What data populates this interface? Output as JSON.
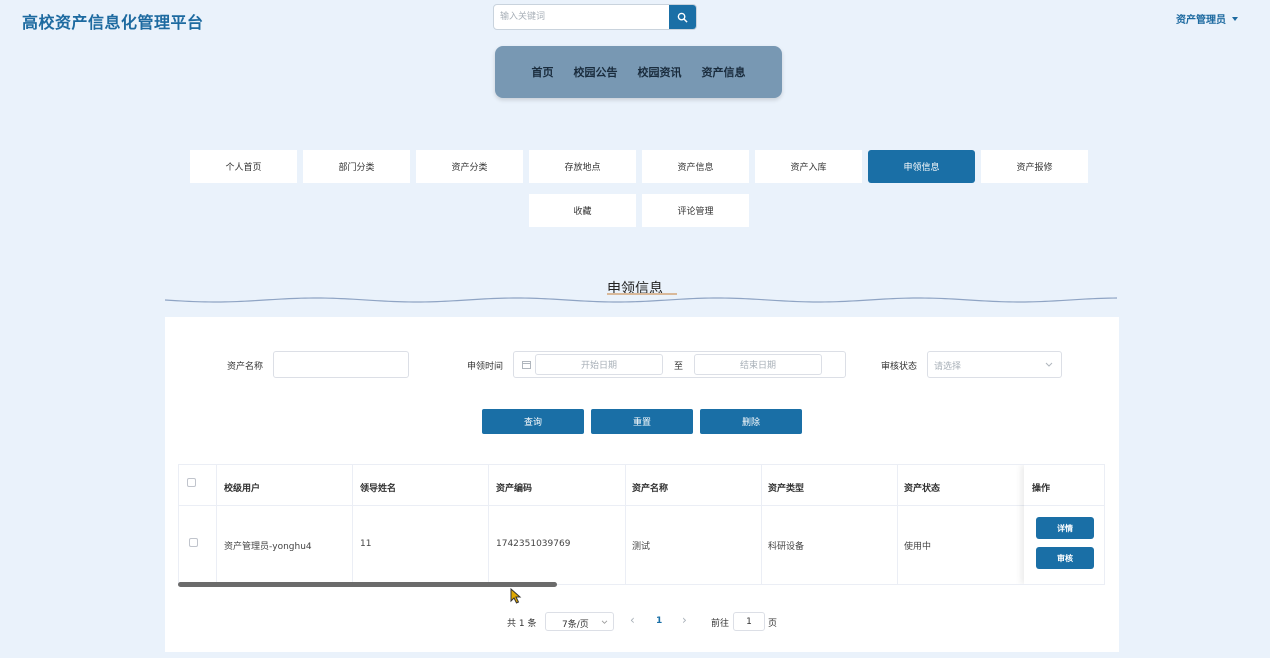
{
  "header": {
    "app_title": "高校资产信息化管理平台",
    "search_placeholder": "输入关键词",
    "user_label": "资产管理员"
  },
  "topnav": [
    "首页",
    "校园公告",
    "校园资讯",
    "资产信息"
  ],
  "tabs": [
    "个人首页",
    "部门分类",
    "资产分类",
    "存放地点",
    "资产信息",
    "资产入库",
    "申领信息",
    "资产报修",
    "收藏",
    "评论管理"
  ],
  "active_tab": "申领信息",
  "section_title": "申领信息",
  "filters": {
    "asset_name_label": "资产名称",
    "apply_time_label": "申领时间",
    "start_placeholder": "开始日期",
    "range_sep": "至",
    "end_placeholder": "结束日期",
    "review_status_label": "审核状态",
    "select_placeholder": "请选择"
  },
  "buttons": {
    "query": "查询",
    "reset": "重置",
    "delete": "删除"
  },
  "table": {
    "columns": [
      "校级用户",
      "领导姓名",
      "资产编码",
      "资产名称",
      "资产类型",
      "资产状态",
      "操作"
    ],
    "rows": [
      {
        "user": "资产管理员-yonghu4",
        "leader": "11",
        "code": "1742351039769",
        "name": "测试",
        "type": "科研设备",
        "status": "使用中"
      }
    ],
    "row_actions": [
      "详情",
      "审核"
    ]
  },
  "pagination": {
    "total": "共 1 条",
    "page_size": "7条/页",
    "prev": "‹",
    "current_page": "1",
    "next": "›",
    "goto_label": "前往",
    "goto_value": "1",
    "page_suffix": "页"
  },
  "colors": {
    "primary": "#1a6fa6",
    "nav_bg": "#7898b3",
    "page_bg": "#eaf2fb"
  },
  "icons": {
    "search": "search-icon",
    "user_caret": "caret-down-icon",
    "calendar": "calendar-icon",
    "select_arrow": "chevron-down-icon"
  }
}
